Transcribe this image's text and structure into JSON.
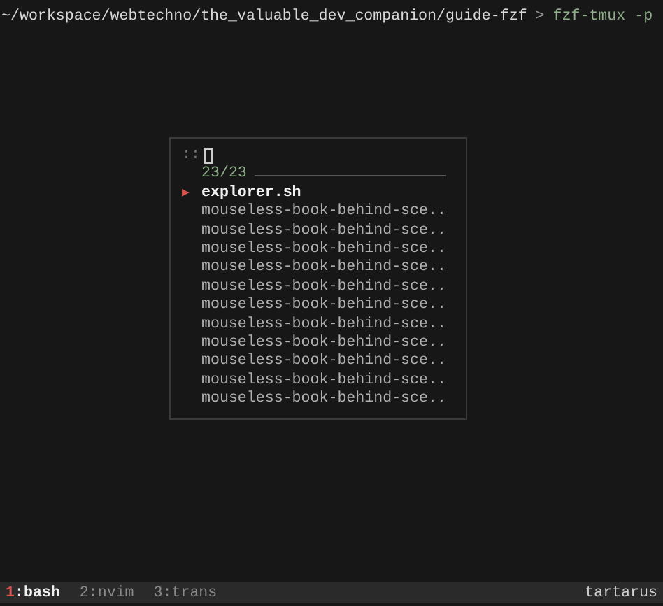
{
  "prompt": {
    "path": "~/workspace/webtechno/the_valuable_dev_companion/guide-fzf",
    "symbol": ">",
    "command": "fzf-tmux -p"
  },
  "fzf": {
    "marker": "::",
    "counter": "23/23",
    "pointer": "▶",
    "items": [
      {
        "label": "explorer.sh",
        "selected": true
      },
      {
        "label": "mouseless-book-behind-sce..",
        "selected": false
      },
      {
        "label": "mouseless-book-behind-sce..",
        "selected": false
      },
      {
        "label": "mouseless-book-behind-sce..",
        "selected": false
      },
      {
        "label": "mouseless-book-behind-sce..",
        "selected": false
      },
      {
        "label": "mouseless-book-behind-sce..",
        "selected": false
      },
      {
        "label": "mouseless-book-behind-sce..",
        "selected": false
      },
      {
        "label": "mouseless-book-behind-sce..",
        "selected": false
      },
      {
        "label": "mouseless-book-behind-sce..",
        "selected": false
      },
      {
        "label": "mouseless-book-behind-sce..",
        "selected": false
      },
      {
        "label": "mouseless-book-behind-sce..",
        "selected": false
      },
      {
        "label": "mouseless-book-behind-sce..",
        "selected": false
      }
    ]
  },
  "status_bar": {
    "windows": [
      {
        "index": "1",
        "name": ":bash",
        "selected": true
      },
      {
        "index": "2",
        "name": ":nvim",
        "selected": false
      },
      {
        "index": "3",
        "name": ":trans",
        "selected": false
      }
    ],
    "host": "tartarus"
  }
}
